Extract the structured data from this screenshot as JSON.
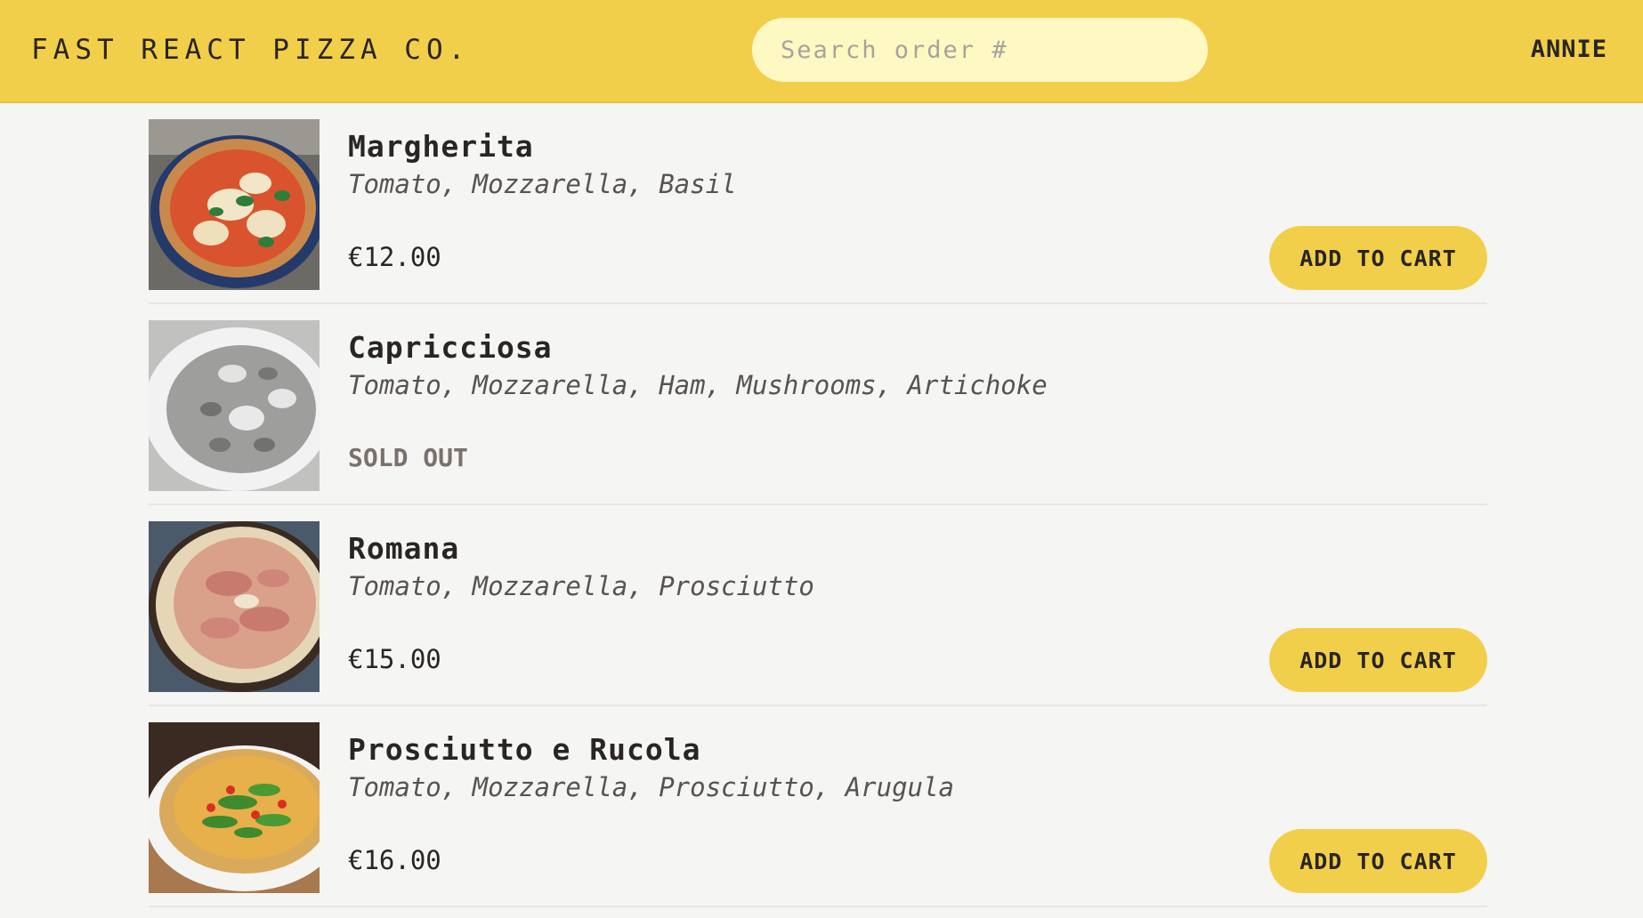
{
  "header": {
    "logo": "Fast React Pizza Co.",
    "search_placeholder": "Search order #",
    "username": "ANNIE"
  },
  "colors": {
    "accent": "#f2cf4a",
    "search_bg": "#fef9c3",
    "page_bg": "#f5f5f4",
    "text": "#292524"
  },
  "menu": {
    "items": [
      {
        "name": "Margherita",
        "ingredients": "Tomato, Mozzarella, Basil",
        "price": "€12.00",
        "sold_out": false,
        "button_label": "Add to cart"
      },
      {
        "name": "Capricciosa",
        "ingredients": "Tomato, Mozzarella, Ham, Mushrooms, Artichoke",
        "sold_out": true,
        "sold_out_label": "Sold out"
      },
      {
        "name": "Romana",
        "ingredients": "Tomato, Mozzarella, Prosciutto",
        "price": "€15.00",
        "sold_out": false,
        "button_label": "Add to cart"
      },
      {
        "name": "Prosciutto e Rucola",
        "ingredients": "Tomato, Mozzarella, Prosciutto, Arugula",
        "price": "€16.00",
        "sold_out": false,
        "button_label": "Add to cart"
      }
    ]
  }
}
